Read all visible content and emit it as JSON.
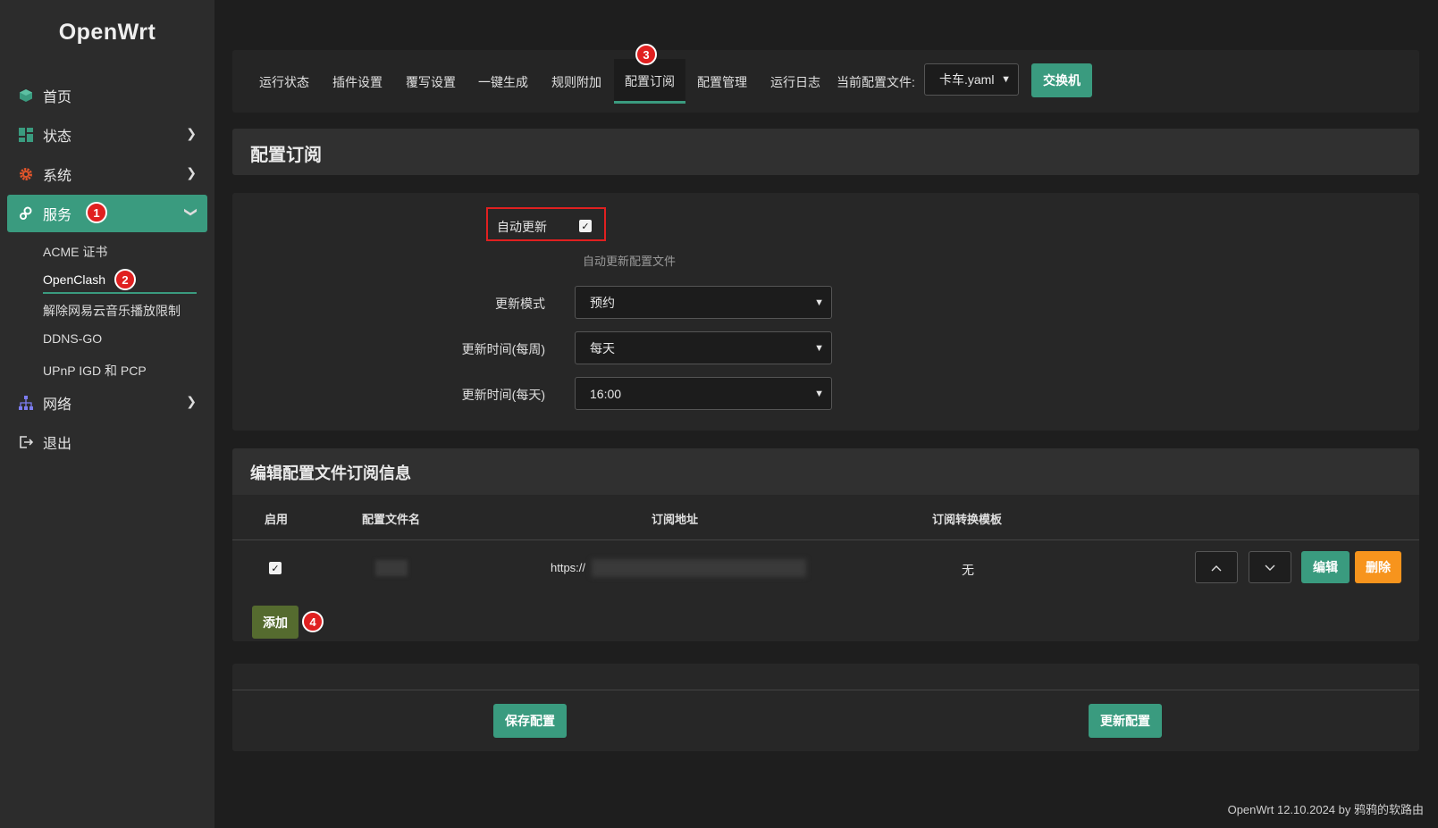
{
  "brand": "OpenWrt",
  "sidebar": {
    "items": [
      {
        "label": "首页",
        "icon": "cube-icon"
      },
      {
        "label": "状态",
        "icon": "dashboard-icon"
      },
      {
        "label": "系统",
        "icon": "gear-icon"
      },
      {
        "label": "服务",
        "icon": "cogs-icon"
      },
      {
        "label": "网络",
        "icon": "network-icon"
      },
      {
        "label": "退出",
        "icon": "logout-icon"
      }
    ],
    "sub_items": [
      "ACME 证书",
      "OpenClash",
      "解除网易云音乐播放限制",
      "DDNS-GO",
      "UPnP IGD 和 PCP"
    ]
  },
  "badges": [
    "1",
    "2",
    "3",
    "4"
  ],
  "tabs": [
    "运行状态",
    "插件设置",
    "覆写设置",
    "一键生成",
    "规则附加",
    "配置订阅",
    "配置管理",
    "运行日志"
  ],
  "config_file": {
    "label": "当前配置文件:",
    "value": "卡车.yaml",
    "switch_button": "交换机"
  },
  "subscription": {
    "title": "配置订阅",
    "auto_update_label": "自动更新",
    "auto_update_checked": true,
    "auto_update_hint": "自动更新配置文件",
    "update_mode_label": "更新模式",
    "update_mode_value": "预约",
    "weekly_label": "更新时间(每周)",
    "weekly_value": "每天",
    "daily_label": "更新时间(每天)",
    "daily_value": "16:00"
  },
  "edit_section": {
    "title": "编辑配置文件订阅信息",
    "columns": [
      "启用",
      "配置文件名",
      "订阅地址",
      "订阅转换模板"
    ],
    "row": {
      "enabled": true,
      "url_prefix": "https://",
      "template": "无"
    },
    "edit_button": "编辑",
    "delete_button": "删除",
    "add_button": "添加"
  },
  "footer_buttons": {
    "save": "保存配置",
    "update": "更新配置"
  },
  "footer_text": "OpenWrt 12.10.2024 by 鸦鸦的软路由",
  "colors": {
    "accent": "#3a9b7f",
    "danger": "#e02020",
    "orange": "#f7941d",
    "olive": "#556b2f"
  }
}
